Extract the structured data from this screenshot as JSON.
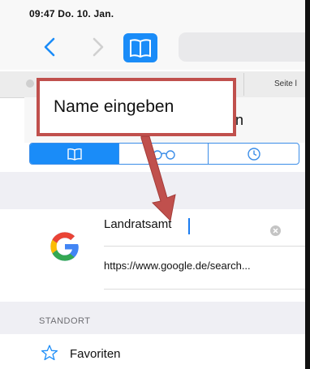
{
  "status_bar": {
    "text": "09:47  Do. 10. Jan."
  },
  "toolbar": {
    "back": "back-icon",
    "forward": "forward-icon",
    "bookmarks": "book-icon"
  },
  "tabbar": {
    "tab_label": "Seite l"
  },
  "header": {
    "title_fragment": "n"
  },
  "segments": [
    "book-icon",
    "reading-list-icon",
    "clock-icon"
  ],
  "bookmark_editor": {
    "name_value": "Landratsamt",
    "url_value": "https://www.google.de/search..."
  },
  "location_section": {
    "label": "STANDORT",
    "folder": "Favoriten"
  },
  "annotation": {
    "text": "Name eingeben"
  },
  "colors": {
    "accent": "#1a8cf8",
    "callout": "#c0504d"
  }
}
